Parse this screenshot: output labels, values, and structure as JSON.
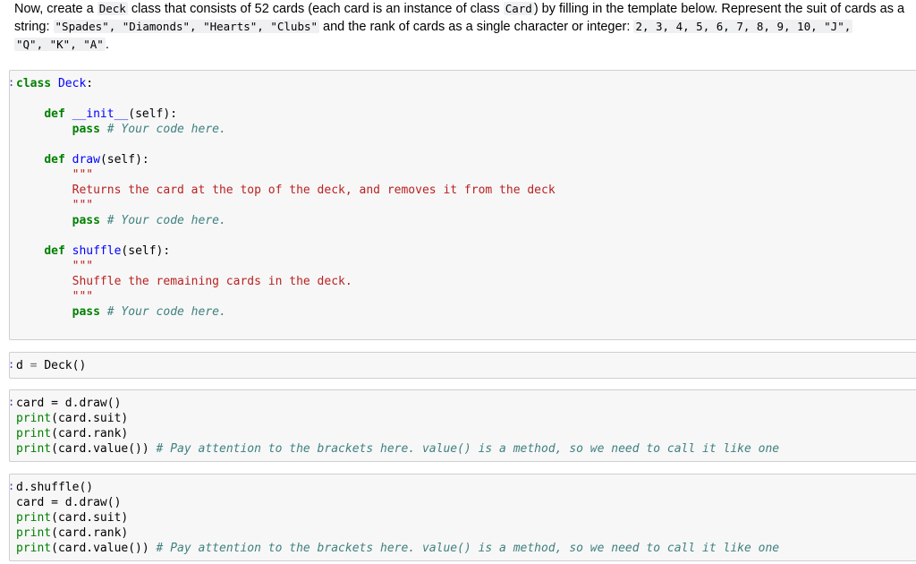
{
  "markdown": {
    "p1": "Now, create a ",
    "c1": "Deck",
    "p2": " class that consists of 52 cards (each card is an instance of class ",
    "c2": "Card",
    "p3": ") by filling in the template below. Represent the suit of cards as a",
    "p4": "string: ",
    "c3": "\"Spades\", \"Diamonds\", \"Hearts\", \"Clubs\"",
    "p5": " and the rank of cards as a single character or integer: ",
    "c4": "2, 3, 4, 5, 6, 7, 8, 9, 10, \"J\",",
    "c5": "\"Q\", \"K\", \"A\"",
    "p6": "."
  },
  "prompt_symbol": ":",
  "cell1": {
    "class_kw": "class",
    "class_name": "Deck",
    "class_colon": ":",
    "def": "def",
    "init_name": "__init__",
    "self_sig": "(self):",
    "pass": "pass",
    "comment": "# Your code here.",
    "draw_name": "draw",
    "shuffle_name": "shuffle",
    "triple_quote": "\"\"\"",
    "draw_doc": "Returns the card at the top of the deck, and removes it from the deck",
    "shuffle_doc": "Shuffle the remaining cards in the deck."
  },
  "cell2": {
    "var": "d",
    "eq": "=",
    "call": "Deck()"
  },
  "cell3": {
    "line1": "card = d.draw()",
    "print_kw": "print",
    "arg_suit": "(card.suit)",
    "arg_rank": "(card.rank)",
    "arg_value": "(card.value())",
    "value_comment": "# Pay attention to the brackets here. value() is a method, so we need to call it like one"
  },
  "cell4": {
    "line0": "d.shuffle()",
    "line1": "card = d.draw()",
    "print_kw": "print",
    "arg_suit": "(card.suit)",
    "arg_rank": "(card.rank)",
    "arg_value": "(card.value())",
    "value_comment": "# Pay attention to the brackets here. value() is a method, so we need to call it like one"
  }
}
